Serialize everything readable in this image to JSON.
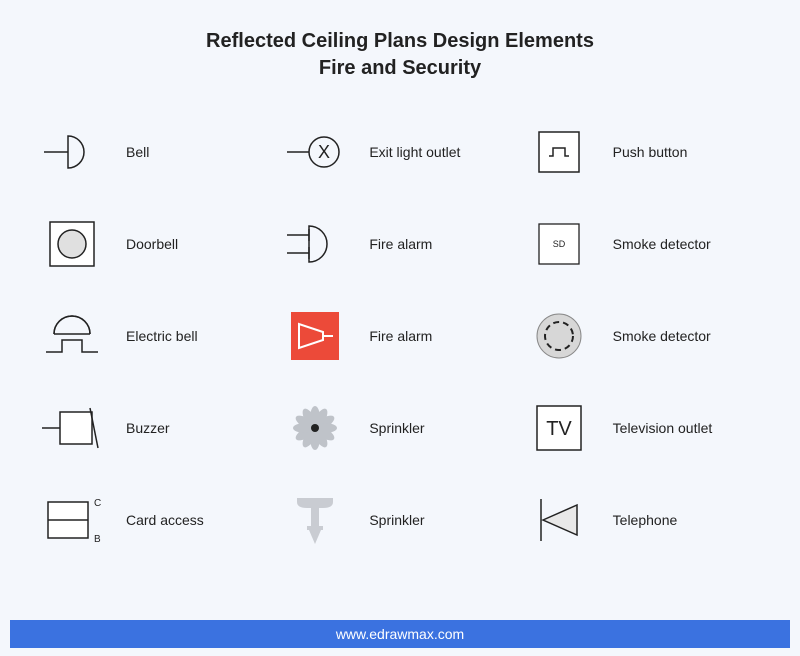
{
  "title": {
    "line1": "Reflected Ceiling Plans Design Elements",
    "line2": "Fire and Security"
  },
  "elements": [
    {
      "name": "bell",
      "label": "Bell"
    },
    {
      "name": "exit-light-outlet",
      "label": "Exit light outlet"
    },
    {
      "name": "push-button",
      "label": "Push button"
    },
    {
      "name": "doorbell",
      "label": "Doorbell"
    },
    {
      "name": "fire-alarm",
      "label": "Fire alarm"
    },
    {
      "name": "smoke-detector-sd",
      "label": "Smoke detector",
      "inner_text": "SD"
    },
    {
      "name": "electric-bell",
      "label": "Electric bell"
    },
    {
      "name": "fire-alarm-red",
      "label": "Fire alarm"
    },
    {
      "name": "smoke-detector-ring",
      "label": "Smoke detector"
    },
    {
      "name": "buzzer",
      "label": "Buzzer"
    },
    {
      "name": "sprinkler-flower",
      "label": "Sprinkler"
    },
    {
      "name": "television-outlet",
      "label": "Television outlet",
      "inner_text": "TV"
    },
    {
      "name": "card-access",
      "label": "Card access",
      "top_letter": "C",
      "bottom_letter": "B"
    },
    {
      "name": "sprinkler-head",
      "label": "Sprinkler"
    },
    {
      "name": "telephone",
      "label": "Telephone"
    }
  ],
  "footer": {
    "url": "www.edrawmax.com"
  },
  "colors": {
    "background": "#f4f7fc",
    "accent_red": "#ec4a39",
    "footer_blue": "#3b72e0",
    "icon_gray": "#d7d7d7",
    "stroke": "#222222"
  }
}
